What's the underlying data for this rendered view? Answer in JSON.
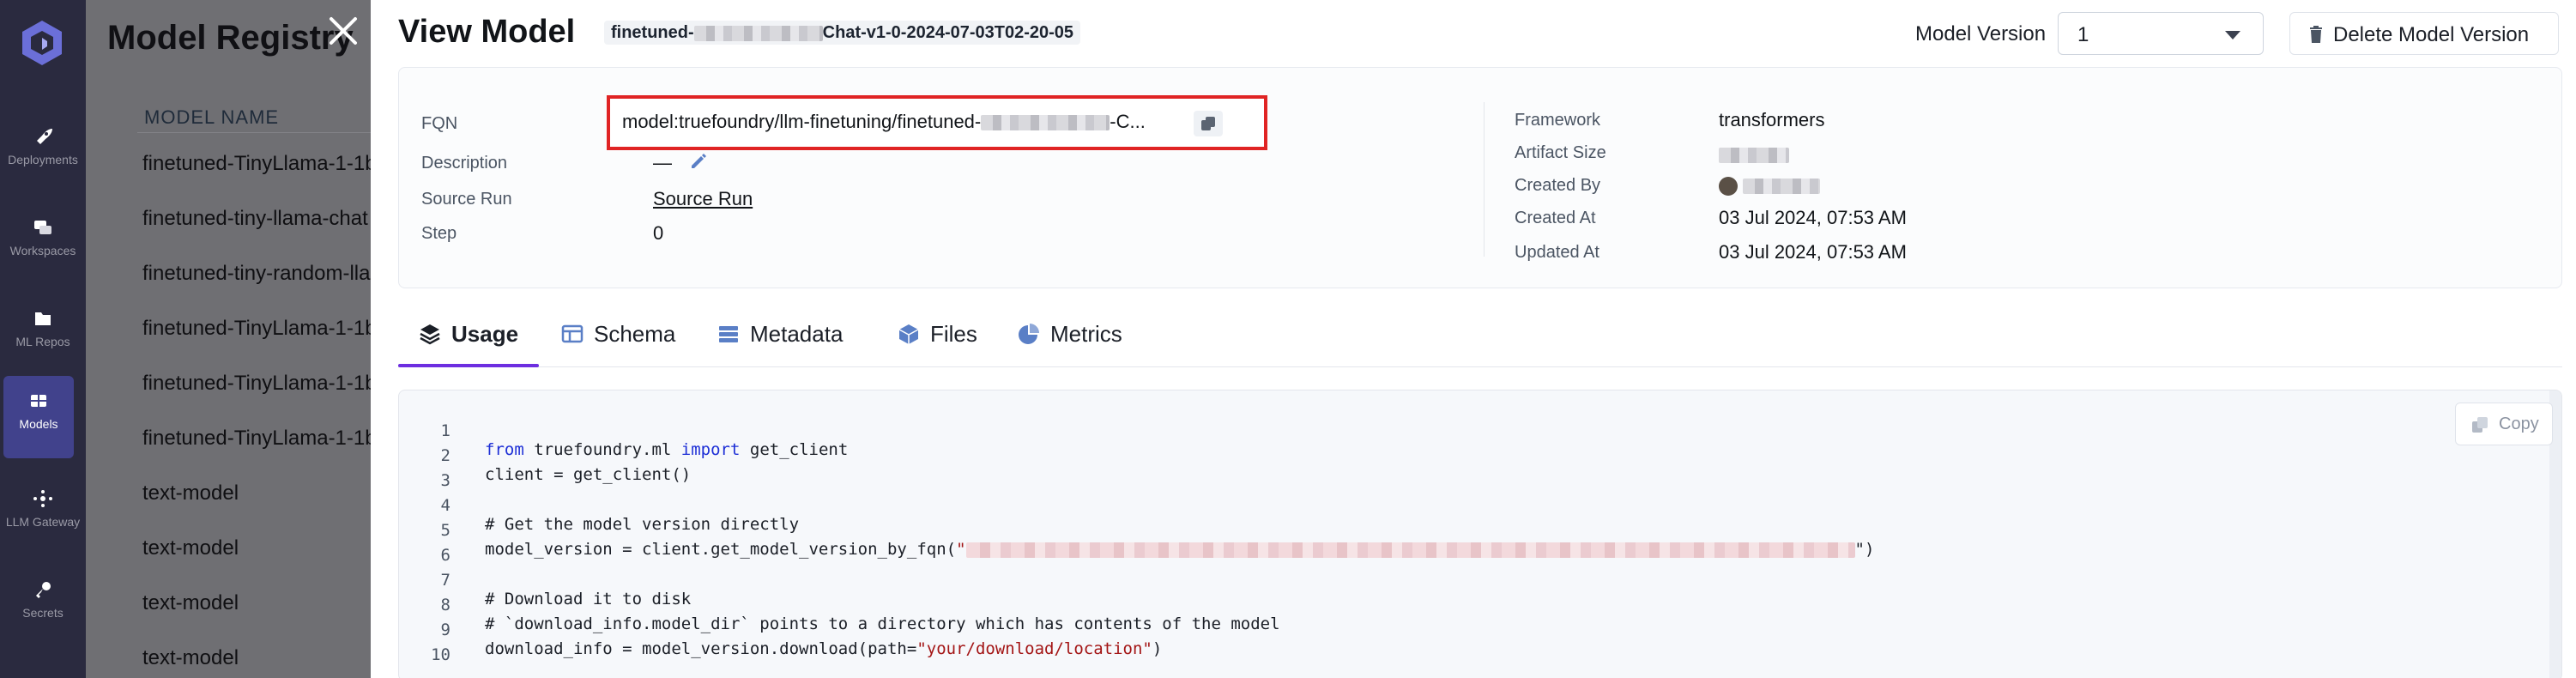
{
  "nav": {
    "items": [
      {
        "label": "Deployments",
        "icon": "rocket-icon"
      },
      {
        "label": "Workspaces",
        "icon": "workspace-icon"
      },
      {
        "label": "ML Repos",
        "icon": "folder-icon"
      },
      {
        "label": "Models",
        "icon": "models-icon"
      },
      {
        "label": "LLM Gateway",
        "icon": "gateway-icon"
      },
      {
        "label": "Secrets",
        "icon": "key-icon"
      }
    ]
  },
  "background": {
    "title": "Model Registry",
    "column_header": "MODEL NAME",
    "rows": [
      "finetuned-TinyLlama-1-1b",
      "finetuned-tiny-llama-chat",
      "finetuned-tiny-random-llama",
      "finetuned-TinyLlama-1-1b",
      "finetuned-TinyLlama-1-1b",
      "finetuned-TinyLlama-1-1b",
      "text-model",
      "text-model",
      "text-model",
      "text-model"
    ]
  },
  "drawer": {
    "title": "View Model",
    "name_prefix": "finetuned-",
    "name_suffix": "Chat-v1-0-2024-07-03T02-20-05",
    "model_version_label": "Model Version",
    "model_version_value": "1",
    "delete_label": "Delete Model Version"
  },
  "details": {
    "fqn_label": "FQN",
    "fqn_prefix": "model:truefoundry/llm-finetuning/finetuned-",
    "fqn_suffix": "-C...",
    "description_label": "Description",
    "description_value": "—",
    "source_run_label": "Source Run",
    "source_run_value": "Source Run",
    "step_label": "Step",
    "step_value": "0",
    "framework_label": "Framework",
    "framework_value": "transformers",
    "artifact_size_label": "Artifact Size",
    "created_by_label": "Created By",
    "created_at_label": "Created At",
    "created_at_value": "03 Jul 2024, 07:53 AM",
    "updated_at_label": "Updated At",
    "updated_at_value": "03 Jul 2024, 07:53 AM"
  },
  "tabs": [
    {
      "label": "Usage",
      "icon": "layers-icon"
    },
    {
      "label": "Schema",
      "icon": "table-icon"
    },
    {
      "label": "Metadata",
      "icon": "list-icon"
    },
    {
      "label": "Files",
      "icon": "cube-icon"
    },
    {
      "label": "Metrics",
      "icon": "pie-chart-icon"
    }
  ],
  "code": {
    "copy_label": "Copy",
    "line_numbers": [
      "1",
      "2",
      "3",
      "4",
      "5",
      "6",
      "7",
      "8",
      "9",
      "10"
    ],
    "l1_kw1": "from",
    "l1_mid": " truefoundry.ml ",
    "l1_kw2": "import",
    "l1_end": " get_client",
    "l2": "client = get_client()",
    "l4": "# Get the model version directly",
    "l5_start": "model_version = client.get_model_version_by_fqn(",
    "l5_quote": "\"",
    "l5_end": "\")",
    "l7": "# Download it to disk",
    "l8": "# `download_info.model_dir` points to a directory which has contents of the model",
    "l9_start": "download_info = model_version.download(path=",
    "l9_str": "\"your/download/location\"",
    "l9_end": ")"
  }
}
